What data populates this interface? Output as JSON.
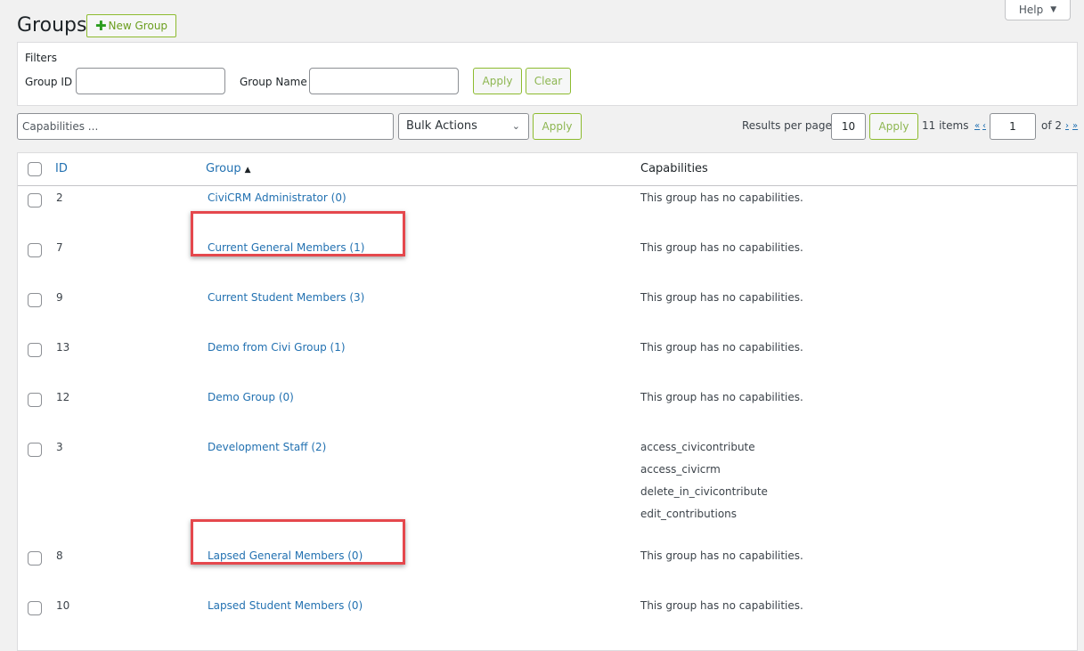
{
  "help": {
    "label": "Help",
    "caret": "▼"
  },
  "page": {
    "title": "Groups",
    "new_group_label": "New Group",
    "new_group_icon": "✚"
  },
  "filters": {
    "title": "Filters",
    "group_id_label": "Group ID",
    "group_id_value": "",
    "group_name_label": "Group Name",
    "group_name_value": "",
    "apply_label": "Apply",
    "clear_label": "Clear"
  },
  "toolbar": {
    "capabilities_placeholder": "Capabilities ...",
    "bulk_actions_label": "Bulk Actions",
    "bulk_chevron": "⌄",
    "apply_label": "Apply",
    "results_per_page_label": "Results per page",
    "results_per_page_value": "10",
    "rpp_apply_label": "Apply",
    "items_count": "11 items",
    "first_page": "«",
    "prev_page": "‹",
    "current_page": "1",
    "of_pages": "of 2",
    "next_page": "›",
    "last_page": "»"
  },
  "table": {
    "headers": {
      "id": "ID",
      "group": "Group",
      "group_sort": "▲",
      "capabilities": "Capabilities"
    },
    "rows": [
      {
        "id": "2",
        "group": "CiviCRM Administrator (0)",
        "capabilities": [
          "This group has no capabilities."
        ],
        "highlighted": false
      },
      {
        "id": "7",
        "group": "Current General Members (1)",
        "capabilities": [
          "This group has no capabilities."
        ],
        "highlighted": true
      },
      {
        "id": "9",
        "group": "Current Student Members (3)",
        "capabilities": [
          "This group has no capabilities."
        ],
        "highlighted": false
      },
      {
        "id": "13",
        "group": "Demo from Civi Group (1)",
        "capabilities": [
          "This group has no capabilities."
        ],
        "highlighted": false
      },
      {
        "id": "12",
        "group": "Demo Group (0)",
        "capabilities": [
          "This group has no capabilities."
        ],
        "highlighted": false
      },
      {
        "id": "3",
        "group": "Development Staff (2)",
        "capabilities": [
          "access_civicontribute",
          "access_civicrm",
          "delete_in_civicontribute",
          "edit_contributions"
        ],
        "highlighted": false
      },
      {
        "id": "8",
        "group": "Lapsed General Members (0)",
        "capabilities": [
          "This group has no capabilities."
        ],
        "highlighted": true
      },
      {
        "id": "10",
        "group": "Lapsed Student Members (0)",
        "capabilities": [
          "This group has no capabilities."
        ],
        "highlighted": false
      }
    ]
  },
  "colors": {
    "link": "#2271b1",
    "accent_green": "#8dbb2f",
    "highlight": "#e5484d"
  }
}
